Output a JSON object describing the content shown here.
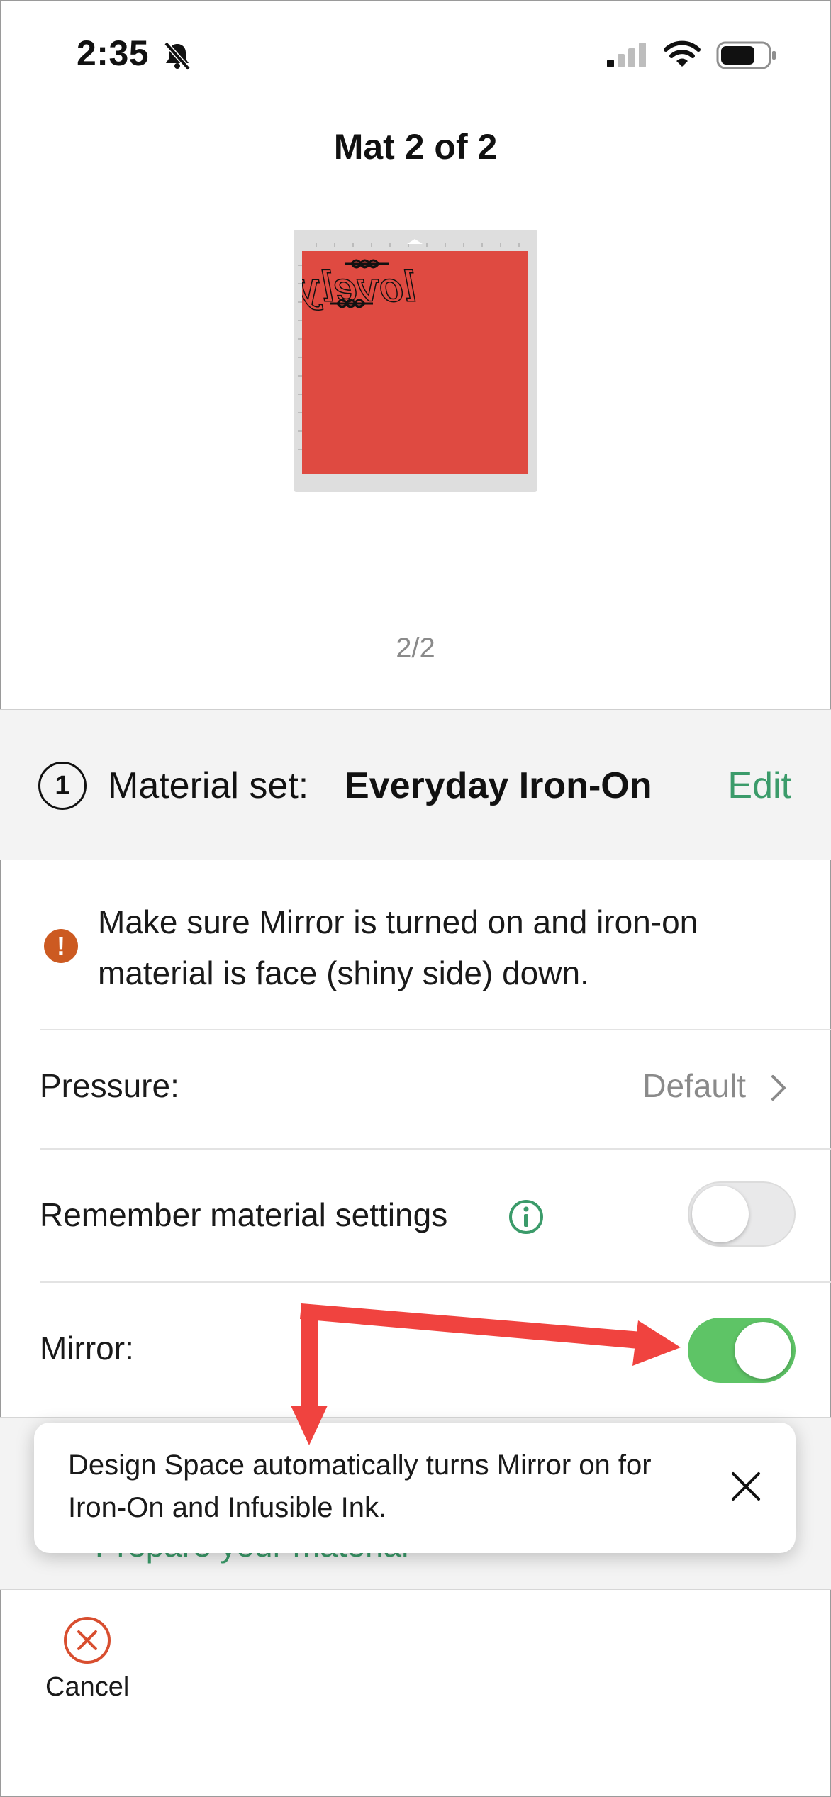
{
  "status_bar": {
    "time": "2:35",
    "icons": [
      "bell-slash-icon",
      "cellular-signal-icon",
      "wifi-icon",
      "battery-icon"
    ]
  },
  "header": {
    "title": "Mat 2 of 2"
  },
  "mat": {
    "color": "#df4a41",
    "design_text": "lovely",
    "pager": "2/2"
  },
  "material": {
    "step_number": "1",
    "label": "Material set:",
    "name": "Everyday Iron-On",
    "edit_label": "Edit"
  },
  "warning": {
    "icon": "warning-icon",
    "text": "Make sure Mirror is turned on and iron-on material is face (shiny side) down."
  },
  "settings": {
    "pressure_label": "Pressure:",
    "pressure_value": "Default",
    "remember_label": "Remember material settings",
    "remember_on": false,
    "mirror_label": "Mirror:",
    "mirror_on": true
  },
  "prepare": {
    "text": "Prepare your material"
  },
  "toast": {
    "text": "Design Space automatically turns Mirror on for Iron-On and Infusible Ink."
  },
  "footer": {
    "cancel_label": "Cancel"
  },
  "colors": {
    "accent": "#3b9b6a",
    "toggle_on": "#5ec466",
    "warning": "#cc5a21",
    "annotation_arrow": "#f0433f"
  }
}
